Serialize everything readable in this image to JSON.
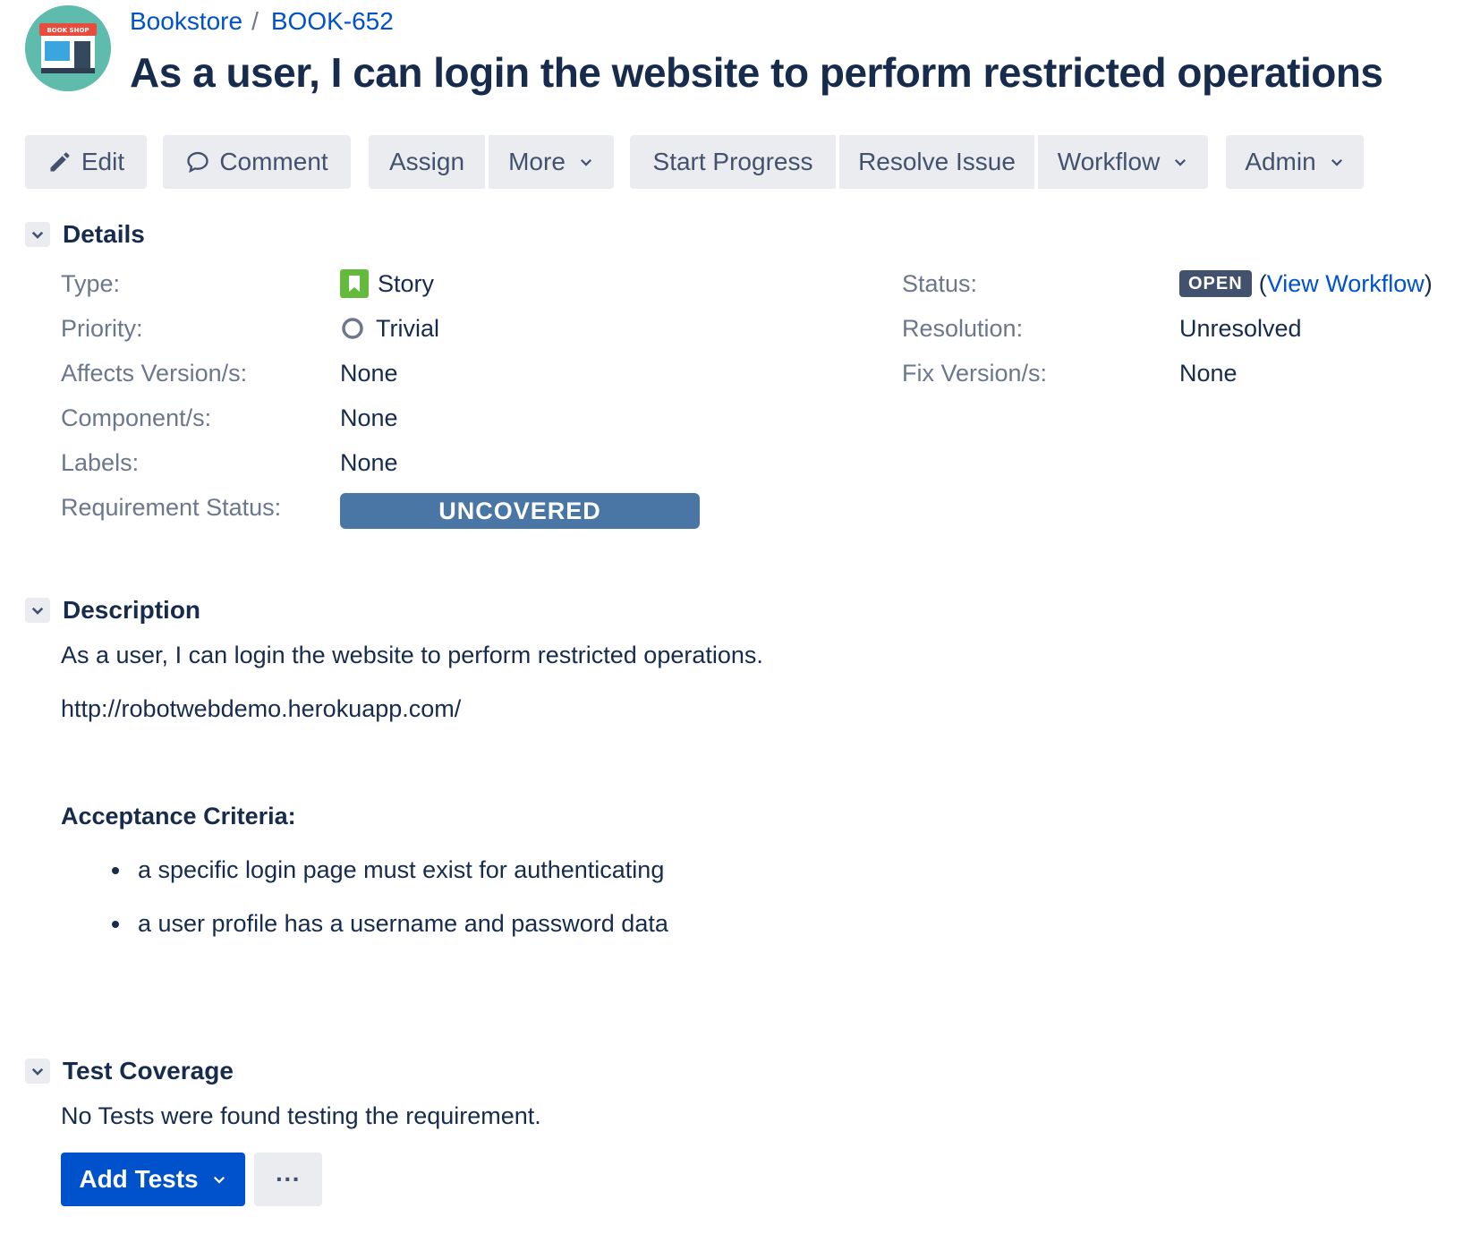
{
  "header": {
    "project_link": "Bookstore",
    "separator": "/",
    "issue_key": "BOOK-652",
    "title": "As a user, I can login the website to perform restricted operations",
    "avatar_text": "BOOK SHOP"
  },
  "toolbar": {
    "edit": "Edit",
    "comment": "Comment",
    "assign": "Assign",
    "more": "More",
    "start_progress": "Start Progress",
    "resolve_issue": "Resolve Issue",
    "workflow": "Workflow",
    "admin": "Admin"
  },
  "details": {
    "heading": "Details",
    "type_label": "Type:",
    "type_value": "Story",
    "priority_label": "Priority:",
    "priority_value": "Trivial",
    "affects_label": "Affects Version/s:",
    "affects_value": "None",
    "component_label": "Component/s:",
    "component_value": "None",
    "labels_label": "Labels:",
    "labels_value": "None",
    "req_status_label": "Requirement Status:",
    "req_status_value": "UNCOVERED",
    "status_label": "Status:",
    "status_value": "OPEN",
    "view_workflow_open": "(",
    "view_workflow": "View Workflow",
    "view_workflow_close": ")",
    "resolution_label": "Resolution:",
    "resolution_value": "Unresolved",
    "fix_label": "Fix Version/s:",
    "fix_value": "None"
  },
  "description": {
    "heading": "Description",
    "text": "As a user, I can login the website to perform restricted operations.",
    "link": "http://robotwebdemo.herokuapp.com/",
    "criteria_heading": "Acceptance Criteria:",
    "criteria": [
      "a specific login page must exist for authenticating",
      "a user profile has a username and password data"
    ]
  },
  "test_coverage": {
    "heading": "Test Coverage",
    "text": "No Tests were found testing the requirement.",
    "add_tests": "Add Tests",
    "more": "···"
  },
  "colors": {
    "link": "#0052cc",
    "primary_button": "#0052cc",
    "requirement_status": "#4a76a5",
    "status_lozenge": "#42526e",
    "story_icon": "#63ba3c",
    "avatar_bg": "#5fbcad"
  }
}
